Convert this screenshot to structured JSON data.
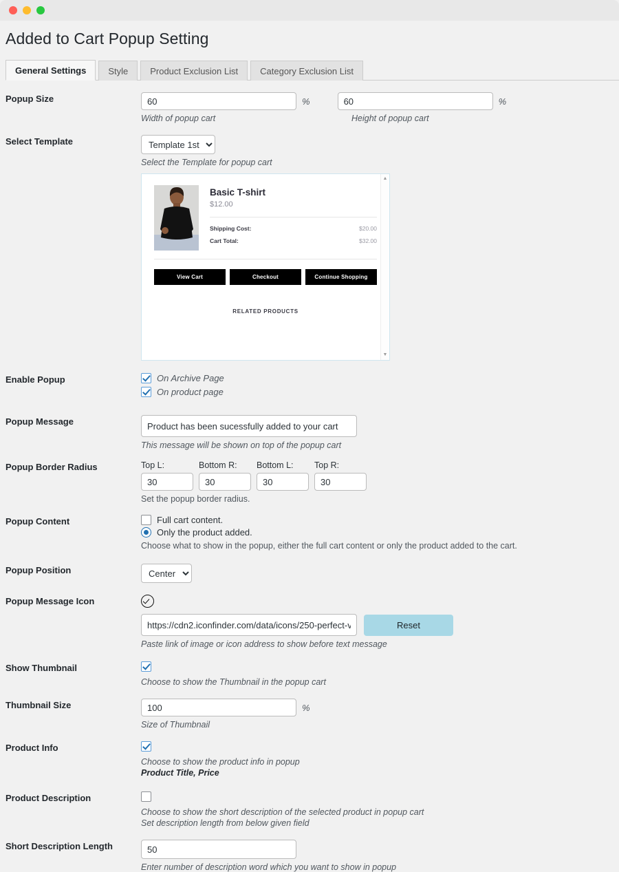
{
  "window": {
    "traffic_lights": [
      "close",
      "minimize",
      "zoom"
    ]
  },
  "page_title": "Added to Cart Popup Setting",
  "tabs": [
    {
      "label": "General Settings",
      "active": true
    },
    {
      "label": "Style",
      "active": false
    },
    {
      "label": "Product Exclusion List",
      "active": false
    },
    {
      "label": "Category Exclusion List",
      "active": false
    }
  ],
  "fields": {
    "popup_size": {
      "label": "Popup Size",
      "width_value": "60",
      "width_unit": "%",
      "width_desc": "Width of popup cart",
      "height_value": "60",
      "height_unit": "%",
      "height_desc": "Height of popup cart"
    },
    "select_template": {
      "label": "Select Template",
      "selected": "Template 1st",
      "options": [
        "Template 1st"
      ],
      "desc": "Select the Template for popup cart"
    },
    "enable_popup": {
      "label": "Enable Popup",
      "options": [
        {
          "label": "On Archive Page",
          "checked": true
        },
        {
          "label": "On product page",
          "checked": true
        }
      ]
    },
    "popup_message": {
      "label": "Popup Message",
      "value": "Product has been sucessfully added to your cart",
      "desc": "This message will be shown on top of the popup cart"
    },
    "popup_border_radius": {
      "label": "Popup Border Radius",
      "corners": [
        {
          "caption": "Top L:",
          "value": "30"
        },
        {
          "caption": "Bottom R:",
          "value": "30"
        },
        {
          "caption": "Bottom L:",
          "value": "30"
        },
        {
          "caption": "Top R:",
          "value": "30"
        }
      ],
      "desc": "Set the popup border radius."
    },
    "popup_content": {
      "label": "Popup Content",
      "options": [
        {
          "label": "Full cart content.",
          "type": "checkbox",
          "selected": false
        },
        {
          "label": "Only the product added.",
          "type": "radio",
          "selected": true
        }
      ],
      "desc": "Choose what to show in the popup, either the full cart content or only the product added to the cart."
    },
    "popup_position": {
      "label": "Popup Position",
      "selected": "Center",
      "options": [
        "Center"
      ]
    },
    "popup_message_icon": {
      "label": "Popup Message Icon",
      "icon": "check-circle-icon",
      "url_value": "https://cdn2.iconfinder.com/data/icons/250-perfect-v",
      "reset_label": "Reset",
      "desc": "Paste link of image or icon address to show before text message"
    },
    "show_thumbnail": {
      "label": "Show Thumbnail",
      "checked": true,
      "desc": "Choose to show the Thumbnail in the popup cart"
    },
    "thumbnail_size": {
      "label": "Thumbnail Size",
      "value": "100",
      "unit": "%",
      "desc": "Size of Thumbnail"
    },
    "product_info": {
      "label": "Product Info",
      "checked": true,
      "desc": "Choose to show the product info in popup",
      "desc_bold": "Product Title, Price"
    },
    "product_description": {
      "label": "Product Description",
      "checked": false,
      "desc": "Choose to show the short description of the selected product in popup cart",
      "desc2": "Set description length from below given field"
    },
    "short_description_length": {
      "label": "Short Description Length",
      "value": "50",
      "desc": "Enter number of description word which you want to show in popup"
    }
  },
  "preview": {
    "product_title": "Basic T-shirt",
    "product_price": "$12.00",
    "lines": [
      {
        "label": "Shipping Cost:",
        "value": "$20.00"
      },
      {
        "label": "Cart Total:",
        "value": "$32.00"
      }
    ],
    "buttons": [
      "View Cart",
      "Checkout",
      "Continue Shopping"
    ],
    "related_label": "RELATED PRODUCTS",
    "scroll_up": "▲",
    "scroll_down": "▼"
  },
  "colors": {
    "accent_checkbox": "#2271b1",
    "reset_button": "#a8d8e6",
    "page_bg": "#f1f1f1"
  }
}
